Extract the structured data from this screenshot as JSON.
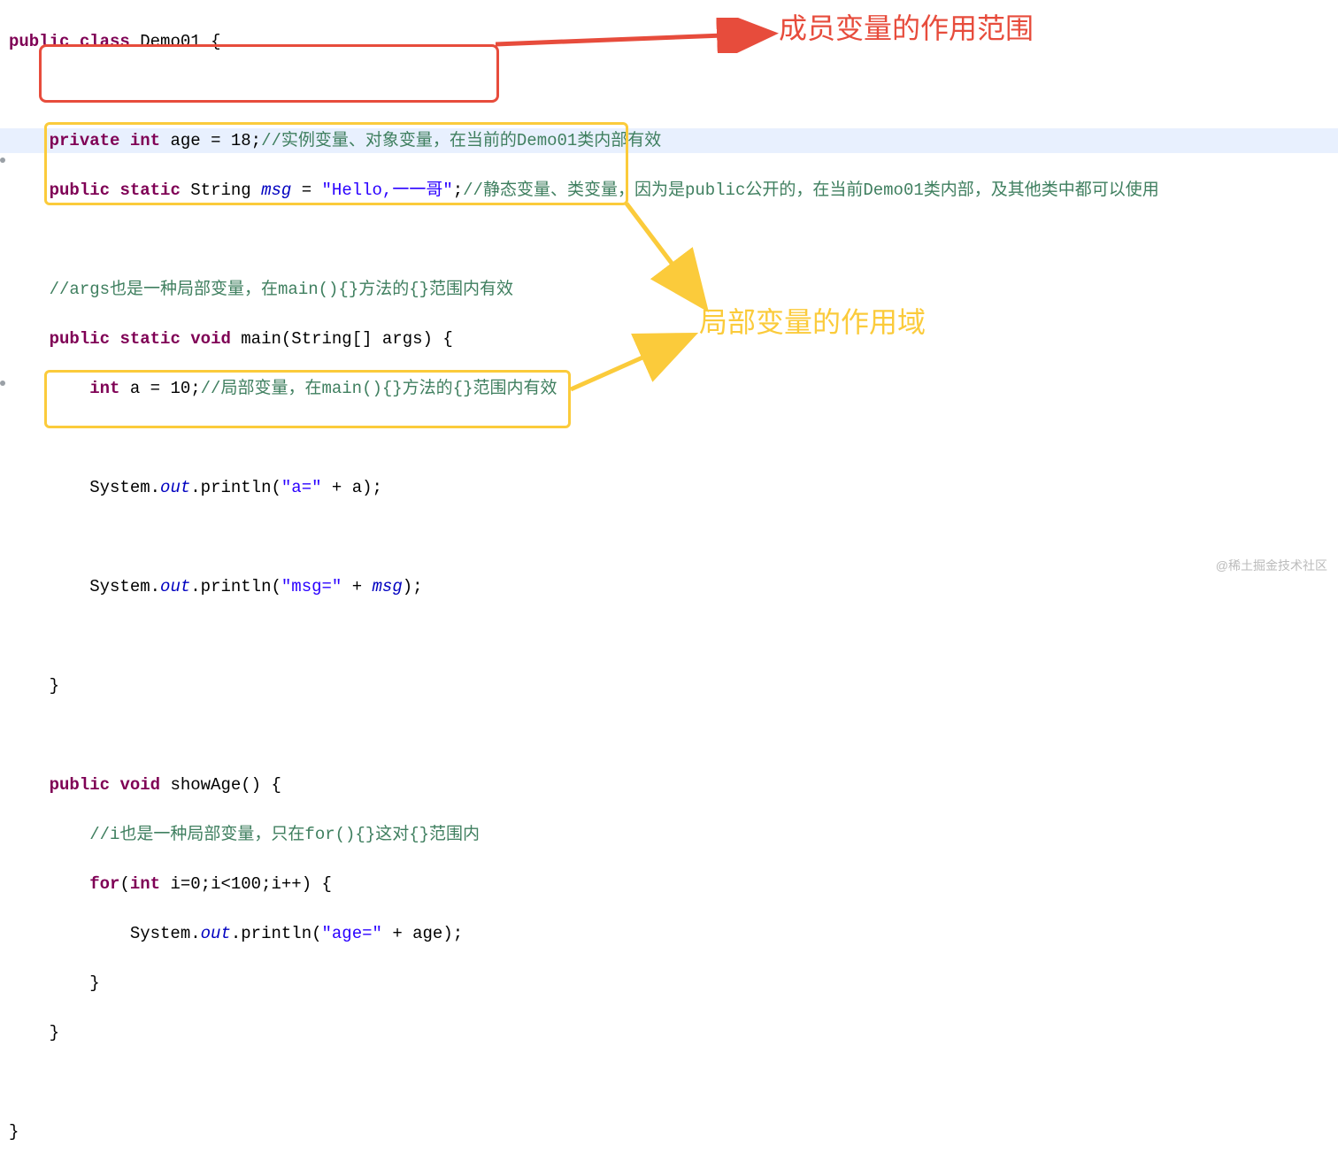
{
  "code": {
    "l1_public": "public",
    "l1_class": "class",
    "l1_name": "Demo01 {",
    "l3_private": "private",
    "l3_int": "int",
    "l3_rest": " age = 18;",
    "l3_comment": "//实例变量、对象变量，在当前的Demo01类内部有效",
    "l4_public": "public",
    "l4_static": "static",
    "l4_type": " String ",
    "l4_msg": "msg",
    "l4_eq": " = ",
    "l4_str": "\"Hello,一一哥\"",
    "l4_semi": ";",
    "l4_comment": "//静态变量、类变量，因为是public公开的，在当前Demo01类内部，及其他类中都可以使用",
    "l6_comment": "//args也是一种局部变量，在main(){}方法的{}范围内有效",
    "l7_public": "public",
    "l7_static": "static",
    "l7_void": "void",
    "l7_sig": " main(String[] args) {",
    "l8_int": "int",
    "l8_rest": " a = 10;",
    "l8_comment": "//局部变量，在main(){}方法的{}范围内有效",
    "l10_sys": "System.",
    "l10_out": "out",
    "l10_print": ".println(",
    "l10_str": "\"a=\"",
    "l10_rest": " + a);",
    "l12_sys": "System.",
    "l12_out": "out",
    "l12_print": ".println(",
    "l12_str": "\"msg=\"",
    "l12_plus": " + ",
    "l12_msg": "msg",
    "l12_end": ");",
    "l14_close": "}",
    "l16_public": "public",
    "l16_void": "void",
    "l16_sig": " showAge() {",
    "l17_comment": "//i也是一种局部变量，只在for(){}这对{}范围内",
    "l18_for": "for",
    "l18_open": "(",
    "l18_int": "int",
    "l18_rest": " i=0;i<100;i++) {",
    "l19_sys": "System.",
    "l19_out": "out",
    "l19_print": ".println(",
    "l19_str": "\"age=\"",
    "l19_rest": " + age);",
    "l20_close": "}",
    "l21_close": "}",
    "l23_close": "}"
  },
  "labels": {
    "member_scope": "成员变量的作用范围",
    "local_scope": "局部变量的作用域"
  },
  "watermark": "@稀土掘金技术社区"
}
